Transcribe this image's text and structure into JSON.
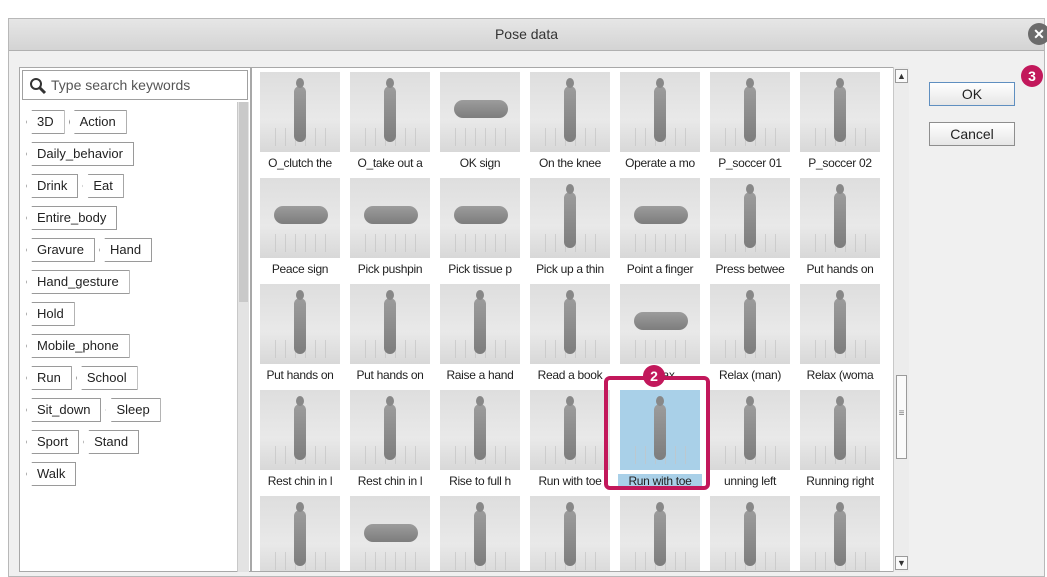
{
  "dialog": {
    "title": "Pose data",
    "close_symbol": "✕"
  },
  "search": {
    "placeholder": "Type search keywords"
  },
  "tags": [
    [
      "3D",
      "Action"
    ],
    [
      "Daily_behavior"
    ],
    [
      "Drink",
      "Eat"
    ],
    [
      "Entire_body"
    ],
    [
      "Gravure",
      "Hand"
    ],
    [
      "Hand_gesture"
    ],
    [
      "Hold"
    ],
    [
      "Mobile_phone"
    ],
    [
      "Run",
      "School"
    ],
    [
      "Sit_down",
      "Sleep"
    ],
    [
      "Sport",
      "Stand"
    ],
    [
      "Walk"
    ]
  ],
  "grid": {
    "rows": [
      [
        "O_clutch the",
        "O_take out a",
        "OK sign",
        "On the knee",
        "Operate a mo",
        "P_soccer 01",
        "P_soccer 02"
      ],
      [
        "Peace sign",
        "Pick pushpin",
        "Pick tissue p",
        "Pick up a thin",
        "Point a finger",
        "Press betwee",
        "Put hands on"
      ],
      [
        "Put hands on",
        "Put hands on",
        "Raise a hand",
        "Read a book",
        "Relax",
        "Relax (man)",
        "Relax (woma"
      ],
      [
        "Rest chin in l",
        "Rest chin in l",
        "Rise to full h",
        "Run with toe",
        "Run with toe",
        "unning left",
        "Running right"
      ],
      [
        "",
        "",
        "",
        "",
        "",
        "",
        ""
      ]
    ],
    "hand_thumbs": [
      [
        0,
        2
      ],
      [
        1,
        0
      ],
      [
        1,
        1
      ],
      [
        1,
        2
      ],
      [
        1,
        4
      ],
      [
        2,
        4
      ],
      [
        4,
        1
      ]
    ],
    "selected": [
      3,
      4
    ]
  },
  "buttons": {
    "ok": "OK",
    "cancel": "Cancel"
  },
  "markers": {
    "selection_step": "2",
    "ok_step": "3"
  },
  "colors": {
    "accent": "#c2185b",
    "selection": "#a9d0e8"
  }
}
